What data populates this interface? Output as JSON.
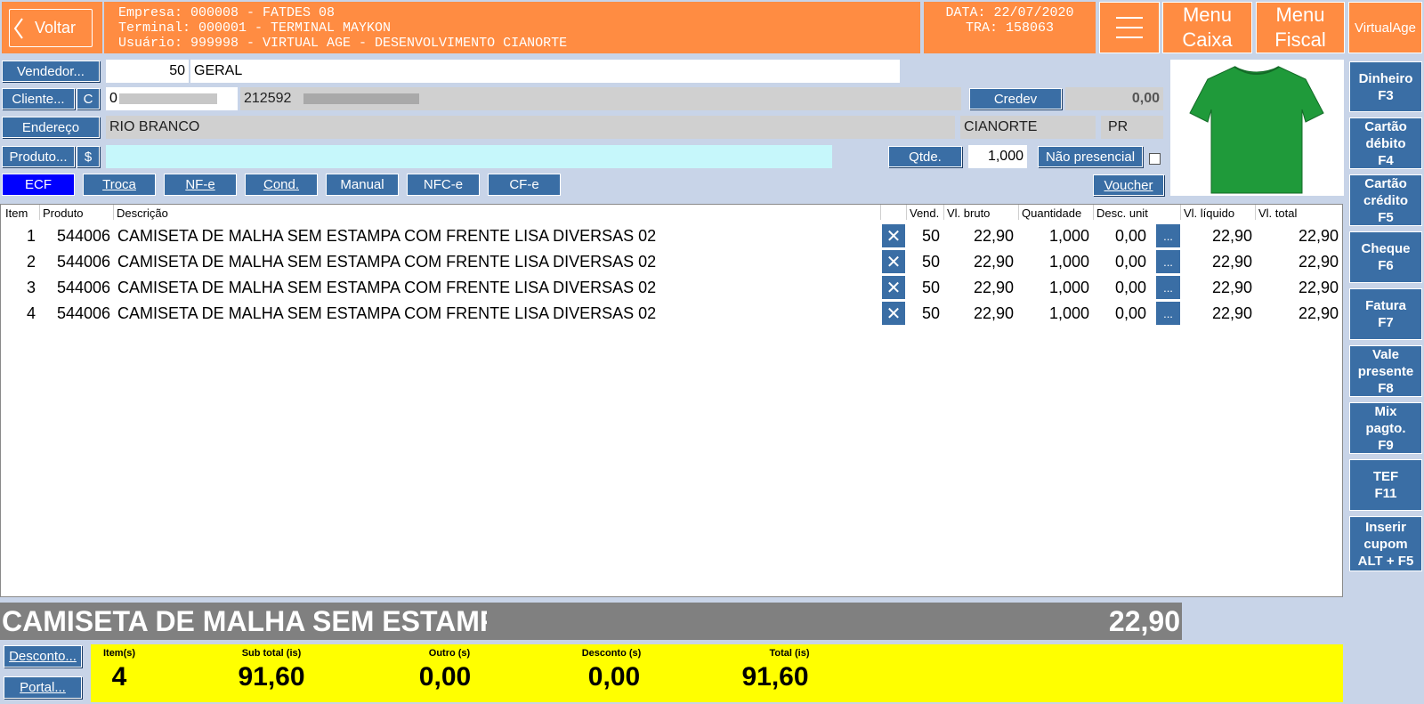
{
  "header": {
    "back_label": "Voltar",
    "empresa": "Empresa: 000008 - FATDES 08",
    "terminal": "Terminal: 000001 - TERMINAL MAYKON",
    "usuario": "Usuário: 999998 - VIRTUAL AGE - DESENVOLVIMENTO CIANORTE",
    "data": "DATA: 22/07/2020",
    "tra": "TRA: 158063",
    "menu_caixa_1": "Menu",
    "menu_caixa_2": "Caixa",
    "menu_fiscal_1": "Menu",
    "menu_fiscal_2": "Fiscal",
    "brand": "VirtualAge"
  },
  "form": {
    "vendedor_label": "Vendedor...",
    "vendedor_code": "50",
    "vendedor_name": "GERAL",
    "cliente_label": "Cliente...",
    "cliente_c": "C",
    "cliente_doc": "0",
    "cliente_code": "212592",
    "credev_label": "Credev",
    "credev_value": "0,00",
    "endereco_label": "Endereço",
    "endereco": "RIO BRANCO",
    "cidade": "CIANORTE",
    "uf": "PR",
    "produto_label": "Produto...",
    "produto_dollar": "$",
    "produto_value": "",
    "qtde_label": "Qtde.",
    "qtde_value": "1,000",
    "nao_presencial": "Não presencial",
    "voucher": "Voucher"
  },
  "tabs": [
    "ECF",
    "Troca",
    "NF-e",
    "Cond.",
    "Manual",
    "NFC-e",
    "CF-e"
  ],
  "columns": {
    "item": "Item",
    "produto": "Produto",
    "descricao": "Descrição",
    "vend": "Vend.",
    "vl_bruto": "Vl. bruto",
    "quantidade": "Quantidade",
    "desc_unit": "Desc. unit",
    "vl_liquido": "Vl. líquido",
    "vl_total": "Vl. total"
  },
  "rows": [
    {
      "item": "1",
      "produto": "544006",
      "descricao": "CAMISETA DE MALHA SEM ESTAMPA COM FRENTE LISA DIVERSAS 02",
      "vend": "50",
      "bruto": "22,90",
      "qtd": "1,000",
      "desc": "0,00",
      "liquido": "22,90",
      "total": "22,90"
    },
    {
      "item": "2",
      "produto": "544006",
      "descricao": "CAMISETA DE MALHA SEM ESTAMPA COM FRENTE LISA DIVERSAS 02",
      "vend": "50",
      "bruto": "22,90",
      "qtd": "1,000",
      "desc": "0,00",
      "liquido": "22,90",
      "total": "22,90"
    },
    {
      "item": "3",
      "produto": "544006",
      "descricao": "CAMISETA DE MALHA SEM ESTAMPA COM FRENTE LISA DIVERSAS 02",
      "vend": "50",
      "bruto": "22,90",
      "qtd": "1,000",
      "desc": "0,00",
      "liquido": "22,90",
      "total": "22,90"
    },
    {
      "item": "4",
      "produto": "544006",
      "descricao": "CAMISETA DE MALHA SEM ESTAMPA COM FRENTE LISA DIVERSAS 02",
      "vend": "50",
      "bruto": "22,90",
      "qtd": "1,000",
      "desc": "0,00",
      "liquido": "22,90",
      "total": "22,90"
    }
  ],
  "row_icons": {
    "remove": "✕",
    "more": "..."
  },
  "fkeys": [
    "Dinheiro\nF3",
    "Cartão\ndébito\nF4",
    "Cartão\ncrédito\nF5",
    "Cheque\nF6",
    "Fatura\nF7",
    "Vale\npresente\nF8",
    "Mix\npagto.\nF9",
    "TEF\nF11",
    "Inserir\ncupom\nALT + F5"
  ],
  "current": {
    "desc": "CAMISETA DE MALHA SEM ESTAMP",
    "value": "22,90"
  },
  "footer": {
    "desconto_label": "Desconto...",
    "portal_label": "Portal...",
    "items_label": "Item(s)",
    "items": "4",
    "subtotal_label": "Sub total (is)",
    "subtotal": "91,60",
    "outro_label": "Outro (s)",
    "outro": "0,00",
    "desconto_sum_label": "Desconto (s)",
    "desconto": "0,00",
    "total_label": "Total (is)",
    "total": "91,60"
  },
  "colors": {
    "header": "#ff8c42",
    "button": "#3a6ea5",
    "ecf_tab": "#0000ff",
    "summary_bg": "#ffff00",
    "shirt": "#1f9a3a"
  }
}
